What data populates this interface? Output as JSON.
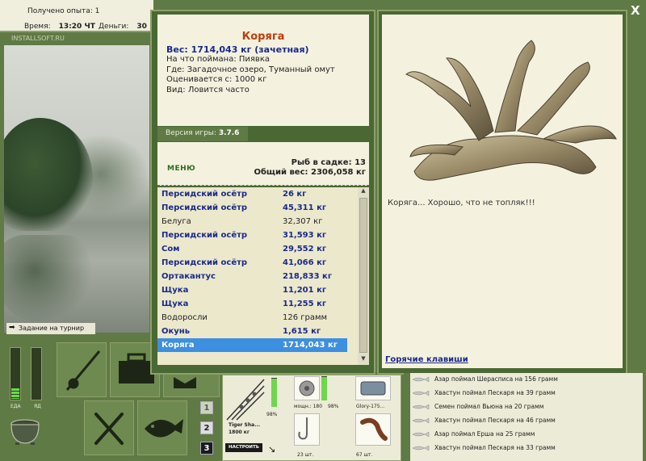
{
  "status": {
    "exp_label": "Получено опыта: 1",
    "time_label": "Время:",
    "time_value": "13:20 ЧТ",
    "money_label": "Деньги:",
    "money_value": "30"
  },
  "watermark": "INSTALLSOFT.RU",
  "tournament": "Задание на турнир",
  "meters": {
    "food_label": "ЕДА",
    "poison_label": "ЯД",
    "food_level": 0.2
  },
  "levels": [
    "1",
    "2",
    "3"
  ],
  "fish": {
    "name": "Коряга",
    "weight": "Вес: 1714,043 кг (зачетная)",
    "bait": "На что поймана: Пиявка",
    "place": "Где: Загадочное озеро, Туманный омут",
    "valued_from": "Оценивается с: 1000 кг",
    "kind": "Вид: Ловится часто"
  },
  "version": {
    "label": "Версия игры:",
    "value": "3.7.6"
  },
  "menu_label": "МЕНЮ",
  "sadok": {
    "count": "Рыб в садке: 13",
    "total": "Общий вес: 2306,058 кг"
  },
  "catch_list": [
    {
      "name": "Персидский осётр",
      "weight": "26 кг",
      "style": "blue"
    },
    {
      "name": "Персидский осётр",
      "weight": "45,311 кг",
      "style": "blue"
    },
    {
      "name": "Белуга",
      "weight": "32,307 кг",
      "style": "plain"
    },
    {
      "name": "Персидский осётр",
      "weight": "31,593 кг",
      "style": "blue"
    },
    {
      "name": "Сом",
      "weight": "29,552 кг",
      "style": "blue"
    },
    {
      "name": "Персидский осётр",
      "weight": "41,066 кг",
      "style": "blue"
    },
    {
      "name": "Ортакантус",
      "weight": "218,833 кг",
      "style": "blue"
    },
    {
      "name": "Щука",
      "weight": "11,201 кг",
      "style": "blue"
    },
    {
      "name": "Щука",
      "weight": "11,255 кг",
      "style": "blue"
    },
    {
      "name": "Водоросли",
      "weight": "126 грамм",
      "style": "plain"
    },
    {
      "name": "Окунь",
      "weight": "1,615 кг",
      "style": "blue"
    },
    {
      "name": "Коряга",
      "weight": "1714,043 кг",
      "style": "sel"
    }
  ],
  "comment": "Коряга... Хорошо, что не топляк!!!",
  "hotkeys": "Горячие клавиши",
  "close": "X",
  "tackle": {
    "rod_name": "Tiger Sha...",
    "rod_test": "1800 кг",
    "rod_pct": "98%",
    "reel_label": "мощн.: 180",
    "reel_pct": "98%",
    "line_label": "Glory-175...",
    "hooks_count": "23 шт.",
    "bait_count": "67 шт.",
    "setup_label": "НАСТРОИТЬ",
    "rod_level": 0.98,
    "reel_level": 0.98
  },
  "chat": [
    "Азар поймал Шерасписа на 156 грамм",
    "Хвастун поймал Пескаря на 39 грамм",
    "Семен поймал Вьюна на 20 грамм",
    "Хвастун поймал Пескаря на 46 грамм",
    "Азар поймал Ерша на 25 грамм",
    "Хвастун поймал Пескаря на 33 грамм"
  ]
}
